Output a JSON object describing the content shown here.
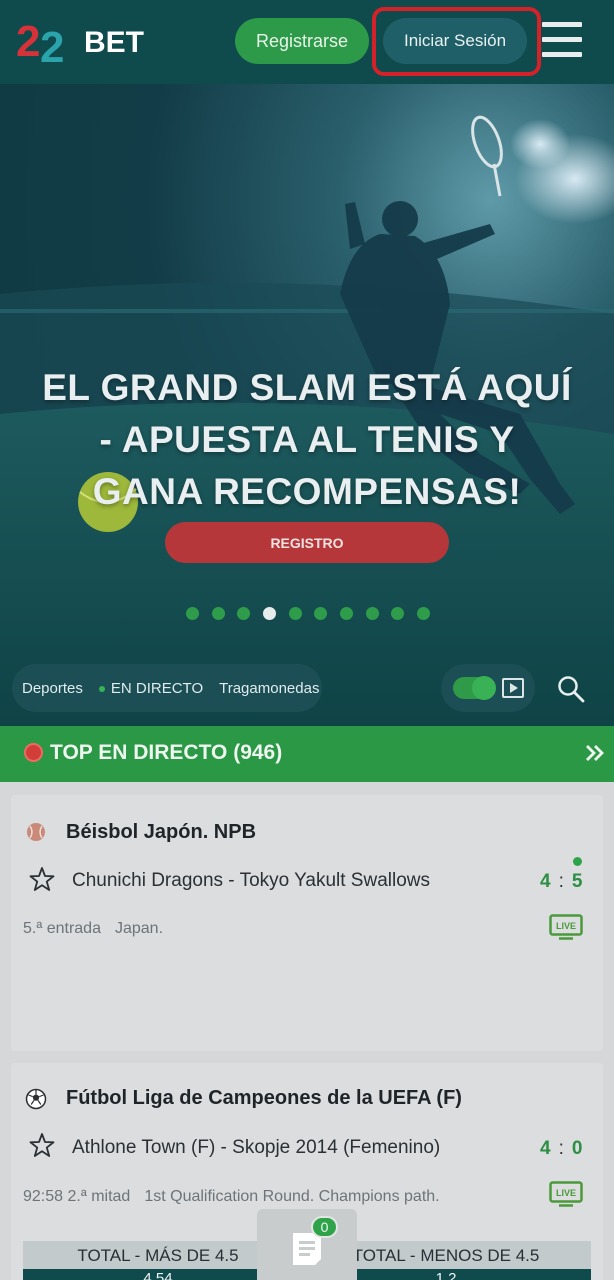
{
  "header": {
    "logo_text": "22BET",
    "register_label": "Registrarse",
    "login_label": "Iniciar Sesión"
  },
  "banner": {
    "title": "EL GRAND SLAM ESTÁ AQUÍ - APUESTA AL TENIS Y GANA RECOMPENSAS!",
    "cta_label": "REGISTRO",
    "slide_count": 10,
    "active_slide": 4
  },
  "nav": {
    "items": [
      "Deportes",
      "EN DIRECTO",
      "Tragamonedas"
    ],
    "live_toggle_on": true
  },
  "section": {
    "title": "TOP EN DIRECTO (946)"
  },
  "events": [
    {
      "league": "Béisbol Japón. NPB",
      "sport_icon": "baseball-icon",
      "match": "Chunichi Dragons - Tokyo Yakult Swallows",
      "score_home": "4",
      "score_away": "5",
      "period": "5.ª entrada",
      "info": "Japan.",
      "live_badge": "LIVE"
    },
    {
      "league": "Fútbol Liga de Campeones de la UEFA (F)",
      "sport_icon": "soccer-ball-icon",
      "match": "Athlone Town (F) - Skopje 2014 (Femenino)",
      "score_home": "4",
      "score_away": "0",
      "period": "92:58 2.ª mitad",
      "info": "1st Qualification Round. Champions path.",
      "live_badge": "LIVE",
      "markets": [
        {
          "label": "TOTAL - MÁS DE 4.5",
          "odds": "4.54"
        },
        {
          "label": "TOTAL - MENOS DE 4.5",
          "odds": "1.2"
        }
      ]
    }
  ],
  "betslip": {
    "count": "0"
  },
  "colors": {
    "brand_dark": "#0f4a4c",
    "brand_green": "#2b9846",
    "cta_red": "#b5373a",
    "highlight_red": "#d3222a"
  }
}
